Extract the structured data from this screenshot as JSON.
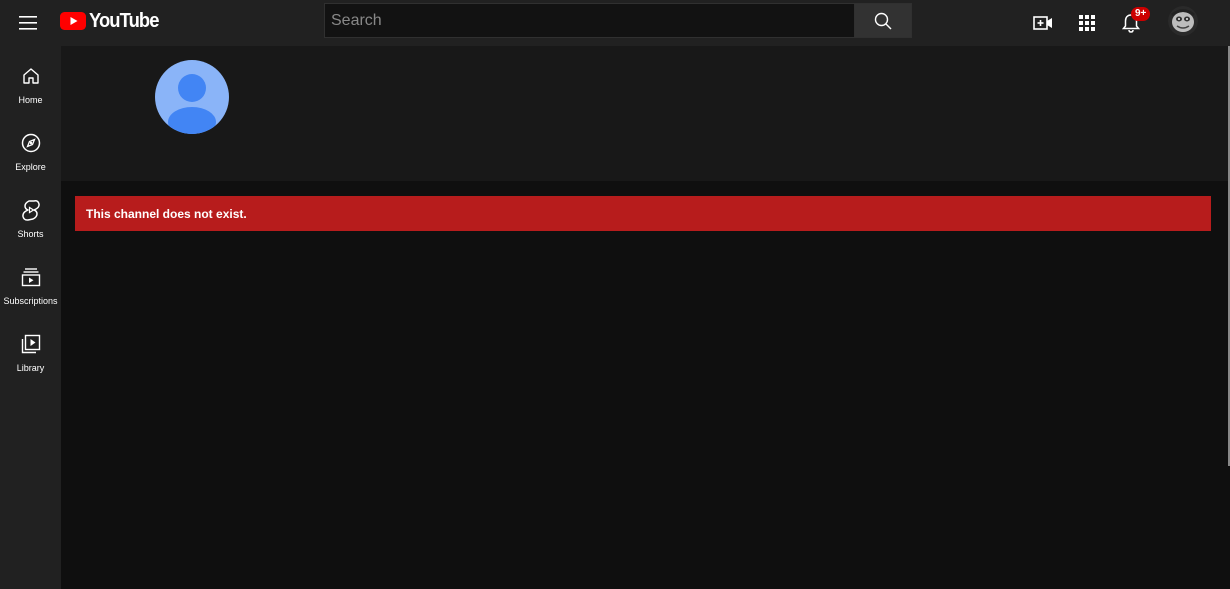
{
  "masthead": {
    "logo_text": "YouTube",
    "search_placeholder": "Search",
    "notification_count": "9+",
    "icons": [
      "menu-icon",
      "search-icon",
      "create-video-icon",
      "apps-grid-icon",
      "bell-icon"
    ]
  },
  "sidebar": {
    "items": [
      {
        "label": "Home",
        "icon": "home-icon"
      },
      {
        "label": "Explore",
        "icon": "compass-icon"
      },
      {
        "label": "Shorts",
        "icon": "shorts-icon"
      },
      {
        "label": "Subscriptions",
        "icon": "subscriptions-icon"
      },
      {
        "label": "Library",
        "icon": "library-icon"
      }
    ]
  },
  "channel": {
    "error_message": "This channel does not exist."
  },
  "colors": {
    "brand_red": "#ff0000",
    "error_banner": "#b71c1c",
    "avatar_blue": "#4285f4",
    "avatar_bg": "#8ab4f8"
  }
}
